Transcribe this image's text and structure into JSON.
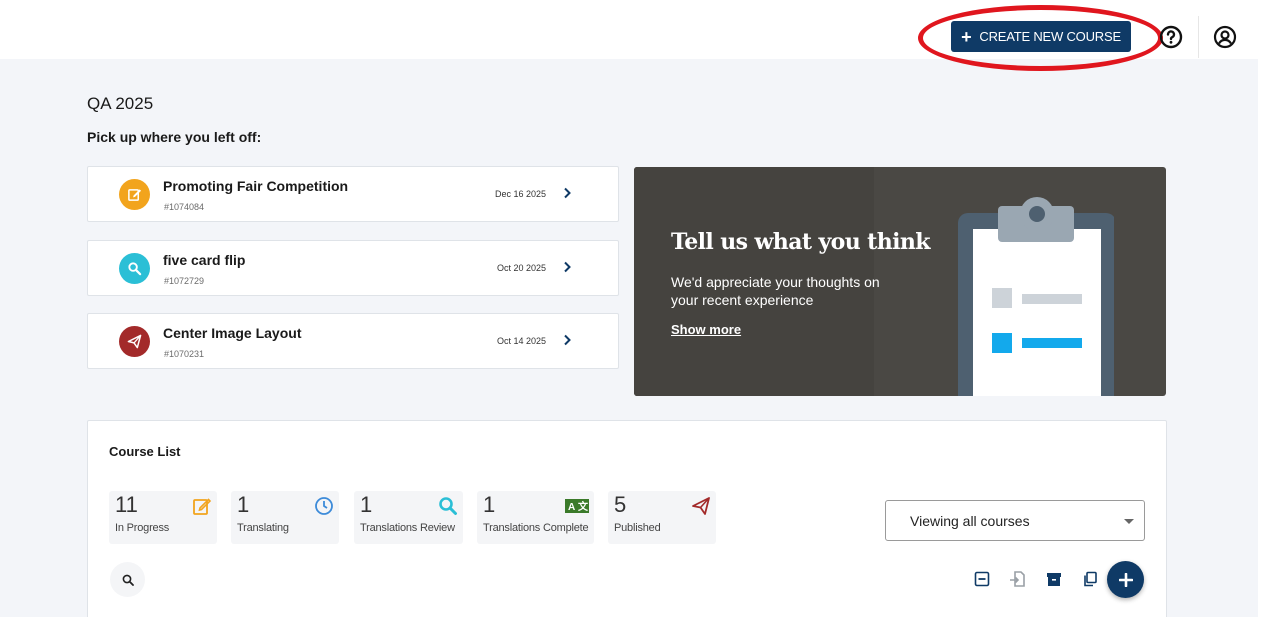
{
  "header": {
    "create_label": "CREATE NEW COURSE",
    "create_icon": "plus-icon",
    "help_icon": "help-circle-icon",
    "user_icon": "user-account-icon"
  },
  "main": {
    "title": "QA 2025",
    "pickup_label": "Pick up where you left off:"
  },
  "recent": [
    {
      "name": "Promoting Fair Competition",
      "id": "#1074084",
      "date": "Dec 16 2025",
      "icon": "edit-icon",
      "color": "#f2a41d"
    },
    {
      "name": "five card flip",
      "id": "#1072729",
      "date": "Oct 20 2025",
      "icon": "search-icon",
      "color": "#2bbfd6"
    },
    {
      "name": "Center Image Layout",
      "id": "#1070231",
      "date": "Oct 14 2025",
      "icon": "send-icon",
      "color": "#a32a2a"
    }
  ],
  "feedback": {
    "title": "Tell us what you think",
    "subtitle": "We'd appreciate your thoughts on your recent experience",
    "link": "Show more",
    "illustration": "clipboard-icon"
  },
  "course_list": {
    "title": "Course List",
    "stats": [
      {
        "count": "11",
        "label": "In Progress",
        "icon": "edit-icon",
        "color": "#f2a41d"
      },
      {
        "count": "1",
        "label": "Translating",
        "icon": "clock-icon",
        "color": "#3d8bd9"
      },
      {
        "count": "1",
        "label": "Translations Review",
        "icon": "search-icon",
        "color": "#2bbfd6"
      },
      {
        "count": "1",
        "label": "Translations Complete",
        "icon": "translate-icon",
        "color": "#3b7a2a"
      },
      {
        "count": "5",
        "label": "Published",
        "icon": "send-icon",
        "color": "#a32a2a"
      }
    ],
    "view_filter": "Viewing all courses",
    "tools": [
      "collapse-icon",
      "import-icon",
      "archive-icon",
      "copy-icon"
    ],
    "add_icon": "plus-icon"
  },
  "colors": {
    "primary": "#0f3a66",
    "highlight": "#e0161e",
    "feedback_bg": "#4a4844",
    "page_bg": "#f3f5f9"
  }
}
